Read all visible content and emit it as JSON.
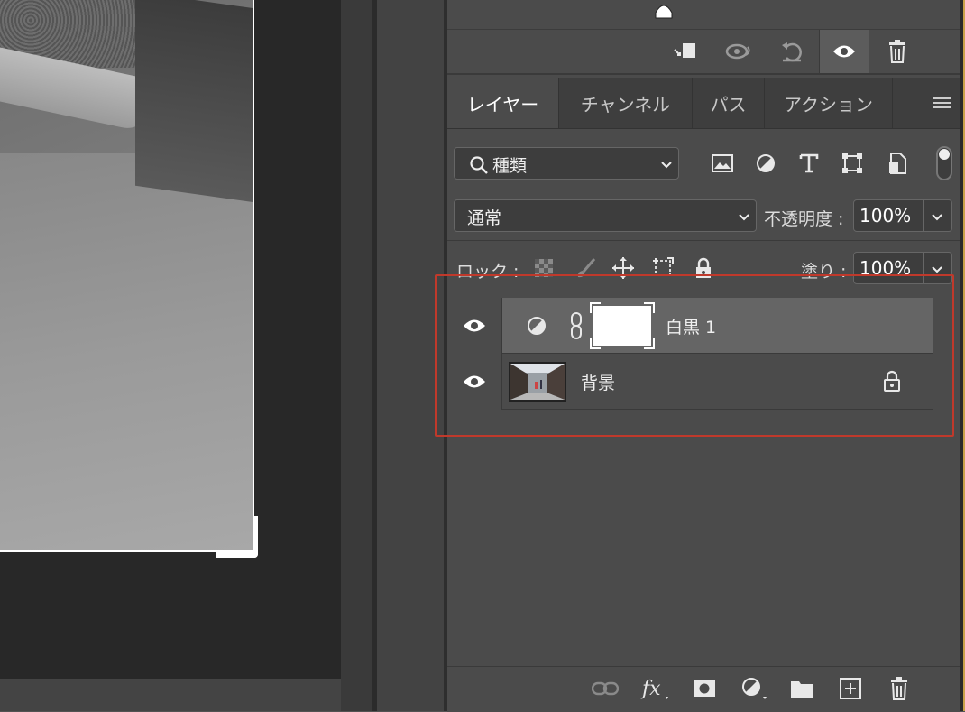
{
  "tabs": [
    {
      "label": "レイヤー",
      "active": true
    },
    {
      "label": "チャンネル",
      "active": false
    },
    {
      "label": "パス",
      "active": false
    },
    {
      "label": "アクション",
      "active": false
    }
  ],
  "filter": {
    "kind_label": "種類",
    "icons": [
      "image-filter-icon",
      "adjustment-filter-icon",
      "type-filter-icon",
      "shape-filter-icon",
      "smart-object-filter-icon"
    ]
  },
  "blend": {
    "mode": "通常",
    "opacity_label": "不透明度 :",
    "opacity_value": "100%"
  },
  "lock": {
    "label": "ロック :",
    "fill_label": "塗り :",
    "fill_value": "100%"
  },
  "layers": [
    {
      "name": "白黒 1",
      "type": "adjustment",
      "selected": true,
      "visible": true
    },
    {
      "name": "背景",
      "type": "background",
      "selected": false,
      "visible": true,
      "locked": true
    }
  ],
  "colors": {
    "panel_bg": "#4b4b4b",
    "selected_row": "#656565",
    "highlight": "#c0392b"
  }
}
